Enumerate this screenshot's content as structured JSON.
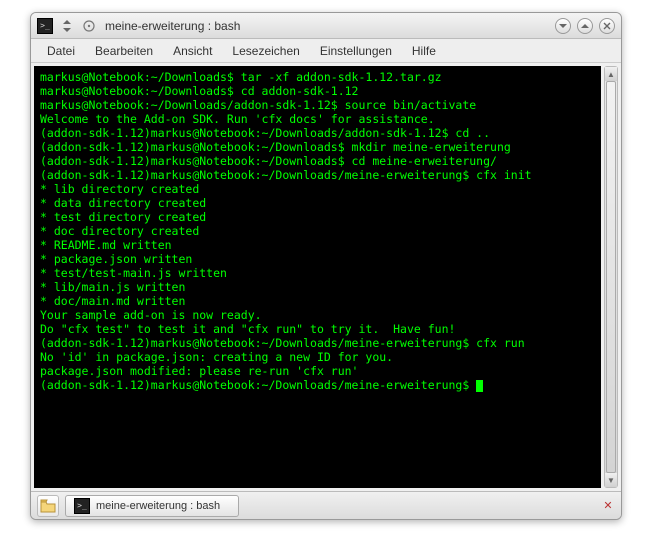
{
  "titlebar": {
    "title": "meine-erweiterung : bash"
  },
  "menu": {
    "file": "Datei",
    "edit": "Bearbeiten",
    "view": "Ansicht",
    "bookmarks": "Lesezeichen",
    "settings": "Einstellungen",
    "help": "Hilfe"
  },
  "term": {
    "lines": [
      "markus@Notebook:~/Downloads$ tar -xf addon-sdk-1.12.tar.gz",
      "markus@Notebook:~/Downloads$ cd addon-sdk-1.12",
      "markus@Notebook:~/Downloads/addon-sdk-1.12$ source bin/activate",
      "Welcome to the Add-on SDK. Run 'cfx docs' for assistance.",
      "(addon-sdk-1.12)markus@Notebook:~/Downloads/addon-sdk-1.12$ cd ..",
      "(addon-sdk-1.12)markus@Notebook:~/Downloads$ mkdir meine-erweiterung",
      "(addon-sdk-1.12)markus@Notebook:~/Downloads$ cd meine-erweiterung/",
      "(addon-sdk-1.12)markus@Notebook:~/Downloads/meine-erweiterung$ cfx init",
      "* lib directory created",
      "* data directory created",
      "* test directory created",
      "* doc directory created",
      "* README.md written",
      "* package.json written",
      "* test/test-main.js written",
      "* lib/main.js written",
      "* doc/main.md written",
      "",
      "Your sample add-on is now ready.",
      "Do \"cfx test\" to test it and \"cfx run\" to try it.  Have fun!",
      "(addon-sdk-1.12)markus@Notebook:~/Downloads/meine-erweiterung$ cfx run",
      "No 'id' in package.json: creating a new ID for you.",
      "package.json modified: please re-run 'cfx run'",
      "(addon-sdk-1.12)markus@Notebook:~/Downloads/meine-erweiterung$ "
    ]
  },
  "taskbar": {
    "task_label": "meine-erweiterung : bash"
  }
}
